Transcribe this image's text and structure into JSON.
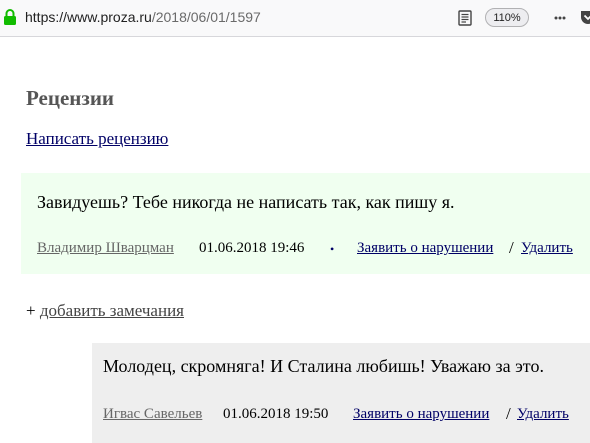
{
  "browser": {
    "url_host": "https://www.proza.ru",
    "url_path": "/2018/06/01/1597",
    "zoom": "110%",
    "icons": [
      "lock-icon",
      "reader-view-icon",
      "more-icon",
      "pocket-icon"
    ]
  },
  "page": {
    "section_title": "Рецензии",
    "write_review": "Написать рецензию"
  },
  "review": {
    "text": "Завидуешь? Тебе никогда не написать так, как пишу я.",
    "author": "Владимир Шварцман",
    "date": "01.06.2018 19:46",
    "bullet": "•",
    "report": "Заявить о нарушении",
    "separator": "/",
    "delete": "Удалить",
    "background": "#f0fff0"
  },
  "add_notes": {
    "plus": "+",
    "label": "добавить замечания"
  },
  "reply": {
    "text": "Молодец, скромняга! И Сталина любишь! Уважаю за это.",
    "author": "Игвас Савельев",
    "date": "01.06.2018 19:50",
    "report": "Заявить о нарушении",
    "separator": "/",
    "delete": "Удалить",
    "background": "#eeeeee"
  },
  "colors": {
    "link": "#000066",
    "title": "#555555",
    "author": "#666666"
  }
}
